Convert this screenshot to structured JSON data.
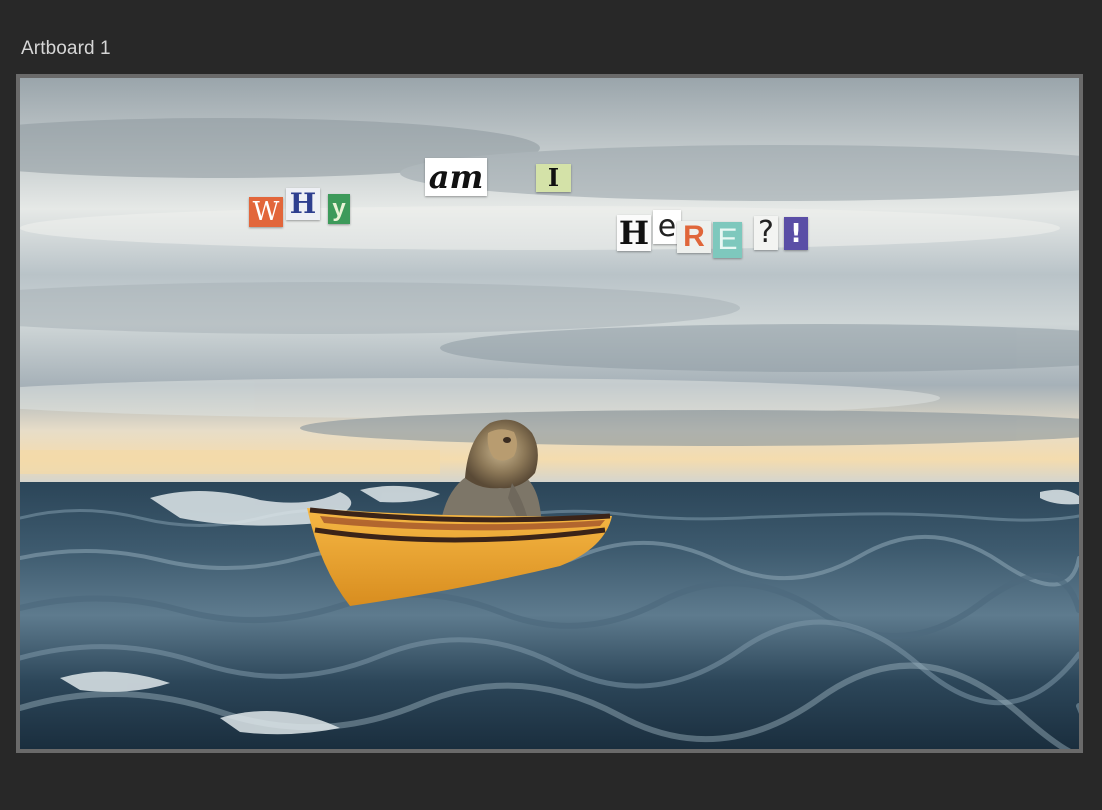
{
  "artboard": {
    "title": "Artboard 1"
  },
  "ransom_note": {
    "words": [
      {
        "word": "WHY",
        "letters": [
          "W",
          "H",
          "y"
        ]
      },
      {
        "word": "am",
        "letters": [
          "am"
        ]
      },
      {
        "word": "I",
        "letters": [
          "I"
        ]
      },
      {
        "word": "HERE",
        "letters": [
          "H",
          "e",
          "R",
          "E"
        ]
      },
      {
        "word": "?!",
        "letters": [
          "?",
          "!"
        ]
      }
    ]
  },
  "colors": {
    "app_background": "#282828",
    "artboard_border": "#6a6a6a",
    "boat_yellow": "#f0a833",
    "boat_stripe": "#3b2418",
    "sea_dark": "#1f3446",
    "sky_light": "#e8ebea"
  },
  "icons": {
    "lion": "lion-in-boat",
    "boat": "rowboat"
  }
}
